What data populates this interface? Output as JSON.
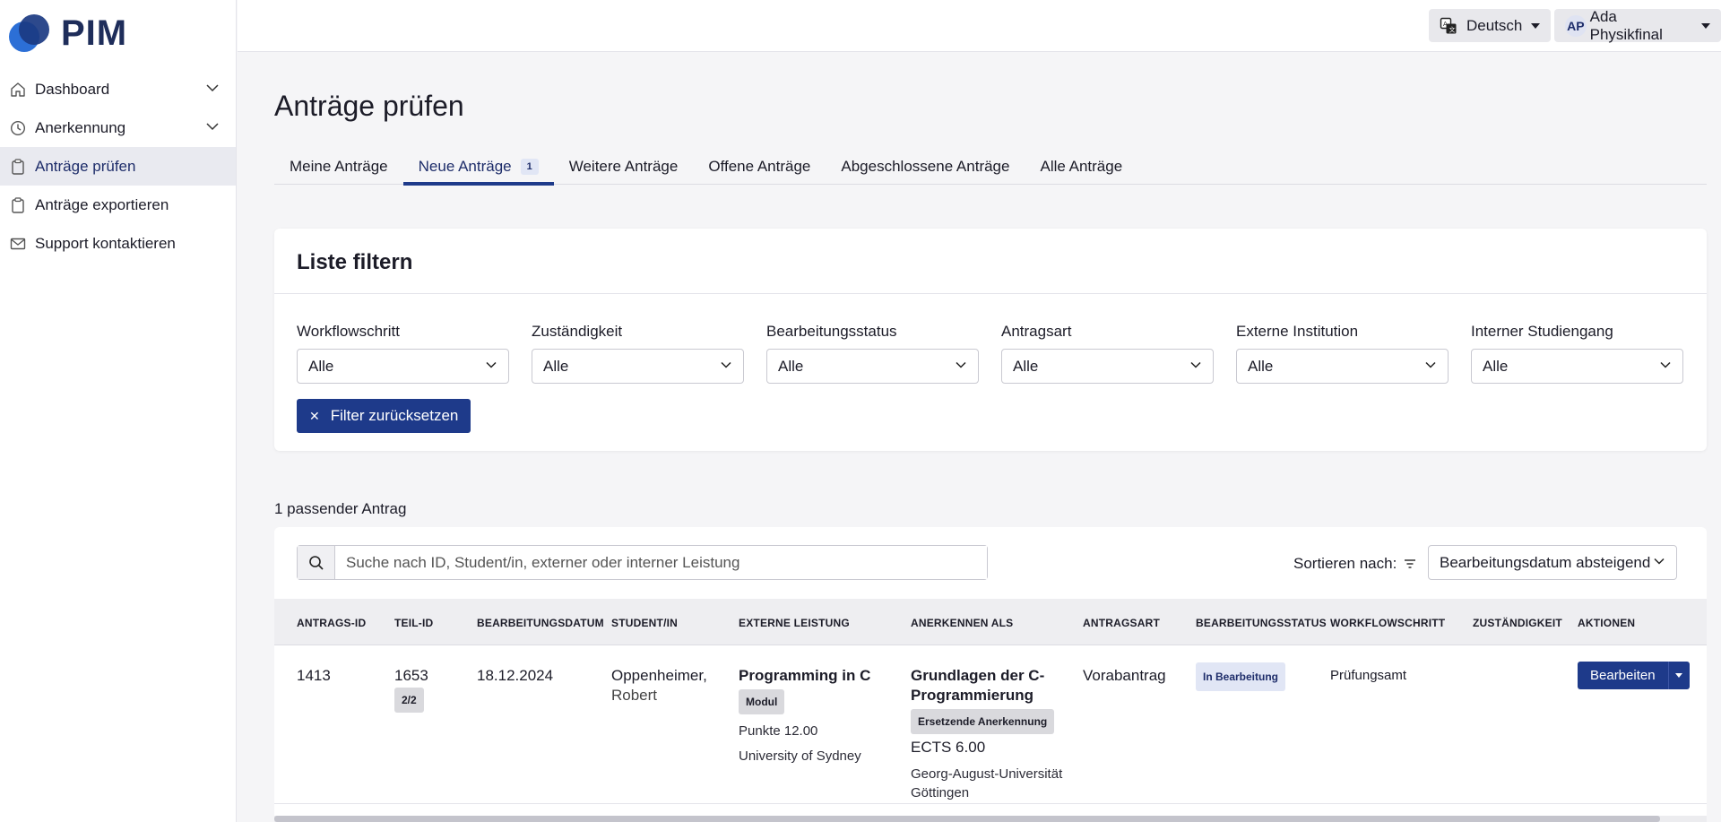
{
  "app": {
    "logo_text": "PIM"
  },
  "sidebar": {
    "items": [
      {
        "label": "Dashboard",
        "icon": "home-icon",
        "expandable": true
      },
      {
        "label": "Anerkennung",
        "icon": "clock-icon",
        "expandable": true
      },
      {
        "label": "Anträge prüfen",
        "icon": "clipboard-icon",
        "active": true
      },
      {
        "label": "Anträge exportieren",
        "icon": "clipboard-icon"
      },
      {
        "label": "Support kontaktieren",
        "icon": "mail-icon"
      }
    ]
  },
  "topbar": {
    "language": "Deutsch",
    "user_initials": "AP",
    "user_name": "Ada Physikfinal"
  },
  "page": {
    "title": "Anträge prüfen"
  },
  "tabs": [
    {
      "label": "Meine Anträge"
    },
    {
      "label": "Neue Anträge",
      "badge": "1",
      "active": true
    },
    {
      "label": "Weitere Anträge"
    },
    {
      "label": "Offene Anträge"
    },
    {
      "label": "Abgeschlossene Anträge"
    },
    {
      "label": "Alle Anträge"
    }
  ],
  "filter": {
    "title": "Liste filtern",
    "fields": [
      {
        "label": "Workflowschritt",
        "value": "Alle"
      },
      {
        "label": "Zuständigkeit",
        "value": "Alle"
      },
      {
        "label": "Bearbeitungsstatus",
        "value": "Alle"
      },
      {
        "label": "Antragsart",
        "value": "Alle"
      },
      {
        "label": "Externe Institution",
        "value": "Alle"
      },
      {
        "label": "Interner Studiengang",
        "value": "Alle"
      }
    ],
    "reset_label": "Filter zurücksetzen"
  },
  "results": {
    "count_label": "1 passender Antrag"
  },
  "search": {
    "placeholder": "Suche nach ID, Student/in, externer oder interner Leistung"
  },
  "sort": {
    "label": "Sortieren nach:",
    "value": "Bearbeitungsdatum absteigend"
  },
  "table": {
    "columns": [
      "ANTRAGS-ID",
      "TEIL-ID",
      "BEARBEITUNGSDATUM",
      "STUDENT/IN",
      "EXTERNE LEISTUNG",
      "ANERKENNEN ALS",
      "ANTRAGSART",
      "BEARBEITUNGSSTATUS",
      "WORKFLOWSCHRITT",
      "ZUSTÄNDIGKEIT",
      "AKTIONEN"
    ],
    "rows": [
      {
        "antrags_id": "1413",
        "teil_id": "1653",
        "teil_badge": "2/2",
        "datum": "18.12.2024",
        "student_last": "Oppenheimer,",
        "student_first": "Robert",
        "ext_title": "Programming in C",
        "ext_type": "Modul",
        "ext_points": "Punkte 12.00",
        "ext_institution": "University of Sydney",
        "int_title_1": "Grundlagen der C-",
        "int_title_2": "Programmierung",
        "int_type": "Ersetzende Anerkennung",
        "int_ects": "ECTS 6.00",
        "int_institution_1": "Georg-August-Universität",
        "int_institution_2": "Göttingen",
        "antragsart": "Vorabantrag",
        "status": "In Bearbeitung",
        "workflow": "Prüfungsamt",
        "zustaendigkeit": "",
        "action_label": "Bearbeiten"
      }
    ]
  },
  "colors": {
    "primary": "#1e3a8a",
    "logo_light": "#2c6fd6",
    "logo_dark": "#1b3a82"
  }
}
